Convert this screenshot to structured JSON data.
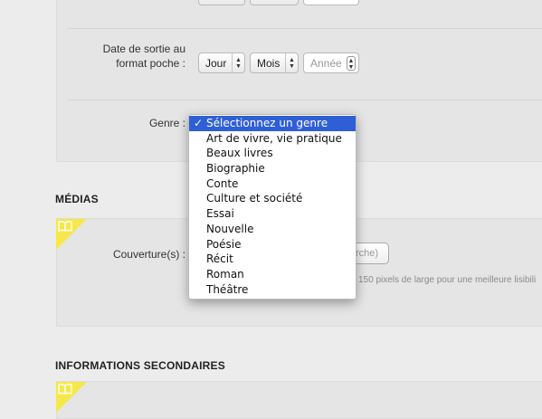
{
  "form": {
    "release_pocket_label_line1": "Date de sortie au",
    "release_pocket_label_line2": "format poche :",
    "day_select": "Jour",
    "month_select": "Mois",
    "year_placeholder": "Année",
    "genre_label": "Genre :"
  },
  "genre_dropdown": {
    "check_mark": "✓",
    "options": [
      "Sélectionnez un genre",
      "Art de vivre, vie pratique",
      "Beaux livres",
      "Biographie",
      "Conte",
      "Culture et société",
      "Essai",
      "Nouvelle",
      "Poésie",
      "Récit",
      "Roman",
      "Théâtre"
    ]
  },
  "medias": {
    "title": "MÉDIAS",
    "cover_label": "Couverture(s) :",
    "browse_button_partial": "rche)",
    "hint_partial": "150 pixels de large pour une meilleure lisibili"
  },
  "secondary": {
    "title": "INFORMATIONS SECONDAIRES"
  },
  "icons": {
    "tag": "book-icon",
    "arrows": "up-down-arrows-icon"
  },
  "colors": {
    "accent_selected": "#2f5fd6",
    "tag_yellow": "#f6e84a"
  }
}
